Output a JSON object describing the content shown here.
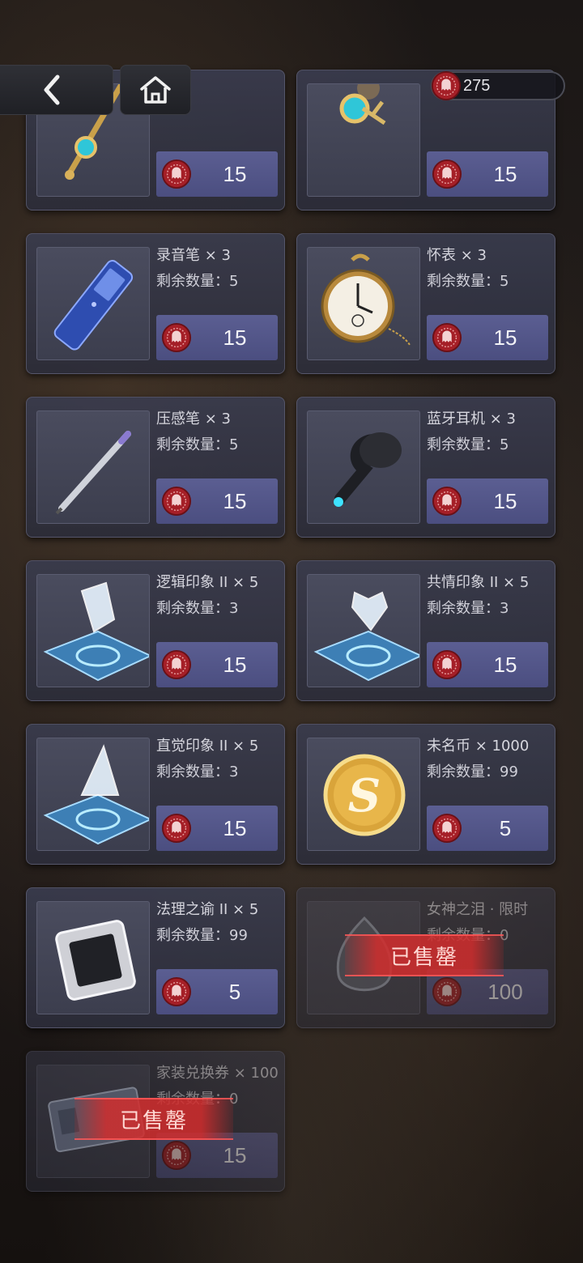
{
  "header": {
    "back_icon": "chevron-left-icon",
    "home_icon": "home-icon",
    "currency_icon": "seal-coin-icon",
    "currency_amount": "275"
  },
  "colors": {
    "price_button": "#5b5e92",
    "coin_red": "#b8232b",
    "soldout_red": "#d02d2d"
  },
  "items": [
    {
      "name": "",
      "stock": "",
      "price": "15",
      "icon": "gold-pin-icon",
      "sold_out": false
    },
    {
      "name": "",
      "stock": "",
      "price": "15",
      "icon": "cufflinks-icon",
      "sold_out": false
    },
    {
      "name": "录音笔 × 3",
      "stock": "剩余数量：5",
      "price": "15",
      "icon": "voice-recorder-icon",
      "sold_out": false
    },
    {
      "name": "怀表 × 3",
      "stock": "剩余数量：5",
      "price": "15",
      "icon": "pocket-watch-icon",
      "sold_out": false
    },
    {
      "name": "压感笔 × 3",
      "stock": "剩余数量：5",
      "price": "15",
      "icon": "stylus-pen-icon",
      "sold_out": false
    },
    {
      "name": "蓝牙耳机 × 3",
      "stock": "剩余数量：5",
      "price": "15",
      "icon": "earbud-icon",
      "sold_out": false
    },
    {
      "name": "逻辑印象 II × 5",
      "stock": "剩余数量：3",
      "price": "15",
      "icon": "hologram-diamond-icon",
      "sold_out": false
    },
    {
      "name": "共情印象 II × 5",
      "stock": "剩余数量：3",
      "price": "15",
      "icon": "hologram-heart-icon",
      "sold_out": false
    },
    {
      "name": "直觉印象 II × 5",
      "stock": "剩余数量：3",
      "price": "15",
      "icon": "hologram-pyramid-icon",
      "sold_out": false
    },
    {
      "name": "未名币 × 1000",
      "stock": "剩余数量：99",
      "price": "5",
      "icon": "gold-coin-icon",
      "sold_out": false
    },
    {
      "name": "法理之谕 II × 5",
      "stock": "剩余数量：99",
      "price": "5",
      "icon": "chip-box-icon",
      "sold_out": false
    },
    {
      "name": "女神之泪 · 限时",
      "stock": "剩余数量：0",
      "price": "100",
      "icon": "teardrop-gem-icon",
      "sold_out": true,
      "sold_label": "已售罄"
    },
    {
      "name": "家装兑换券 × 100",
      "stock": "剩余数量：0",
      "price": "15",
      "icon": "ticket-icon",
      "sold_out": true,
      "sold_label": "已售罄"
    }
  ]
}
